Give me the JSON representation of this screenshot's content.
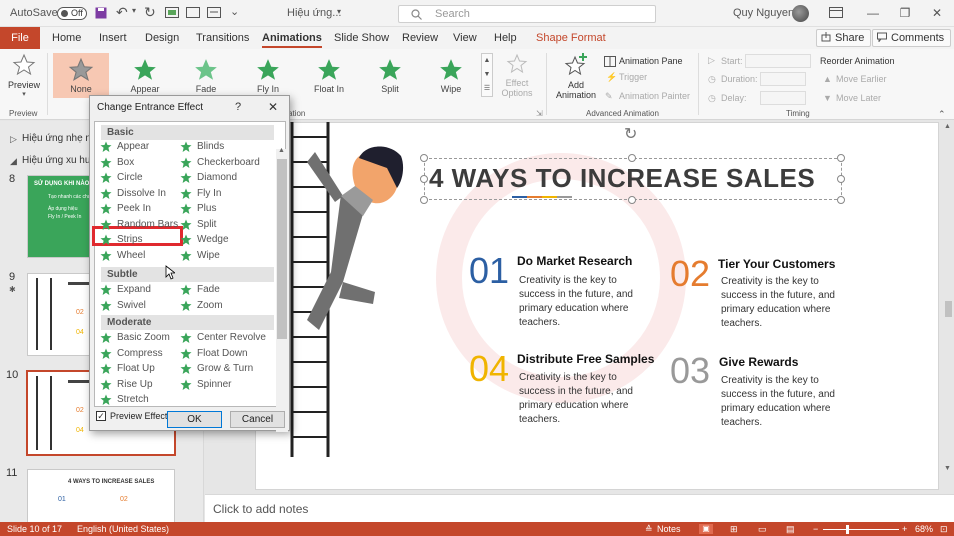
{
  "titlebar": {
    "autosave": "AutoSave",
    "toggle": "Off",
    "doc_name": "Hiệu ứng...",
    "search_placeholder": "Search",
    "user": "Quy Nguyen"
  },
  "tabs": [
    "File",
    "Home",
    "Insert",
    "Design",
    "Transitions",
    "Animations",
    "Slide Show",
    "Review",
    "View",
    "Help",
    "Shape Format"
  ],
  "share_label": "Share",
  "comments_label": "Comments",
  "ribbon": {
    "preview": "Preview",
    "preview_group": "Preview",
    "effects": [
      "None",
      "Appear",
      "Fade",
      "Fly In",
      "Float In",
      "Split",
      "Wipe"
    ],
    "effect_options": "Effect Options",
    "group_animation_tail": "ation",
    "add_animation": "Add Animation",
    "animation_pane": "Animation Pane",
    "trigger": "Trigger",
    "animation_painter": "Animation Painter",
    "advanced_group": "Advanced Animation",
    "start": "Start:",
    "duration": "Duration:",
    "delay": "Delay:",
    "timing_group": "Timing",
    "reorder": "Reorder Animation",
    "move_earlier": "Move Earlier",
    "move_later": "Move Later"
  },
  "left_panel": {
    "sections": [
      "Hiệu ứng nhẹ nhà",
      "Hiệu ứng xu hướ"
    ],
    "slide_numbers": [
      "8",
      "9",
      "10",
      "11"
    ],
    "thumb8_title": "SỬ DỤNG KHI NÀO?",
    "thumb8_lines": [
      "Tạo nhanh các chuyển",
      "Áp dụng hiệu",
      "Fly In / Peek In"
    ],
    "thumb11_title": "4 WAYS TO INCREASE SALES"
  },
  "dialog": {
    "title": "Change Entrance Effect",
    "help": "?",
    "close": "✕",
    "categories": [
      "Basic",
      "Subtle",
      "Moderate"
    ],
    "basic_left": [
      "Appear",
      "Box",
      "Circle",
      "Dissolve In",
      "Peek In",
      "Random Bars",
      "Strips",
      "Wheel"
    ],
    "basic_right": [
      "Blinds",
      "Checkerboard",
      "Diamond",
      "Fly In",
      "Plus",
      "Split",
      "Wedge",
      "Wipe"
    ],
    "subtle_left": [
      "Expand",
      "Swivel"
    ],
    "subtle_right": [
      "Fade",
      "Zoom"
    ],
    "moderate_left": [
      "Basic Zoom",
      "Compress",
      "Float Up",
      "Rise Up",
      "Stretch"
    ],
    "moderate_right": [
      "Center Revolve",
      "Float Down",
      "Grow & Turn",
      "Spinner"
    ],
    "preview_effect": "Preview Effect",
    "ok": "OK",
    "cancel": "Cancel"
  },
  "slide": {
    "title": "4 WAYS TO INCREASE SALES",
    "items": [
      {
        "num": "01",
        "heading": "Do Market Research",
        "body": [
          "Creativity is the key to",
          "success in the future, and",
          "primary education where",
          "teachers."
        ],
        "color": "#2c5fa3"
      },
      {
        "num": "02",
        "heading": "Tier Your Customers",
        "body": [
          "Creativity is the key to",
          "success in the future, and",
          "primary education where",
          "teachers."
        ],
        "color": "#e57c2f"
      },
      {
        "num": "04",
        "heading": "Distribute Free Samples",
        "body": [
          "Creativity is the key to",
          "success in the future, and",
          "primary education where",
          "teachers."
        ],
        "color": "#f0b400"
      },
      {
        "num": "03",
        "heading": "Give Rewards",
        "body": [
          "Creativity is the key to",
          "success in the future, and",
          "primary education where",
          "teachers."
        ],
        "color": "#999999"
      }
    ]
  },
  "notes_placeholder": "Click to add notes",
  "status": {
    "slide": "Slide 10 of 17",
    "language": "English (United States)",
    "notes": "Notes",
    "zoom": "68%"
  },
  "colors": {
    "accent": "#c4472b",
    "highlight": "#e0292e",
    "star_green": "#3aa55a"
  }
}
